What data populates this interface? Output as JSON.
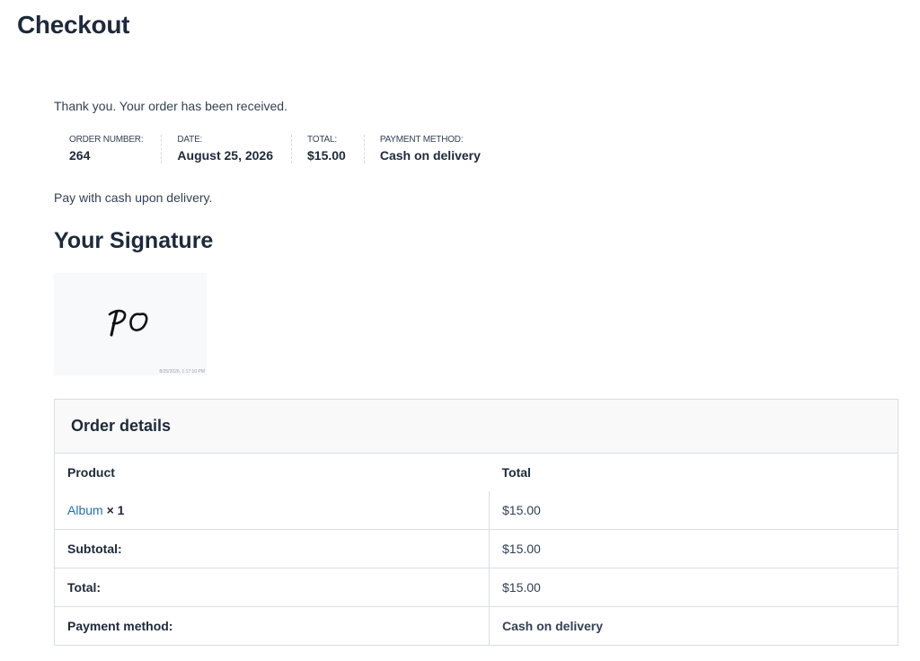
{
  "page": {
    "title": "Checkout"
  },
  "order": {
    "thank_you": "Thank you. Your order has been received.",
    "overview": {
      "order_number_label": "ORDER NUMBER:",
      "order_number": "264",
      "date_label": "DATE:",
      "date": "August 25, 2026",
      "total_label": "TOTAL:",
      "total": "$15.00",
      "payment_method_label": "PAYMENT METHOD:",
      "payment_method": "Cash on delivery"
    },
    "payment_note": "Pay with cash upon delivery."
  },
  "signature": {
    "heading": "Your Signature",
    "initials": "PO",
    "timestamp": "8/25/2026, 1:17:10 PM"
  },
  "order_details": {
    "heading": "Order details",
    "columns": [
      "Product",
      "Total"
    ],
    "items": [
      {
        "product": "Album",
        "quantity": "× 1",
        "total": "$15.00"
      }
    ],
    "totals": [
      {
        "label": "Subtotal:",
        "value": "$15.00"
      },
      {
        "label": "Total:",
        "value": "$15.00"
      },
      {
        "label": "Payment method:",
        "value": "Cash on delivery"
      }
    ]
  },
  "colors": {
    "link": "#2271b1",
    "text": "#1e293b",
    "border": "#d9dde2",
    "header_bg": "#f9f9f9"
  }
}
